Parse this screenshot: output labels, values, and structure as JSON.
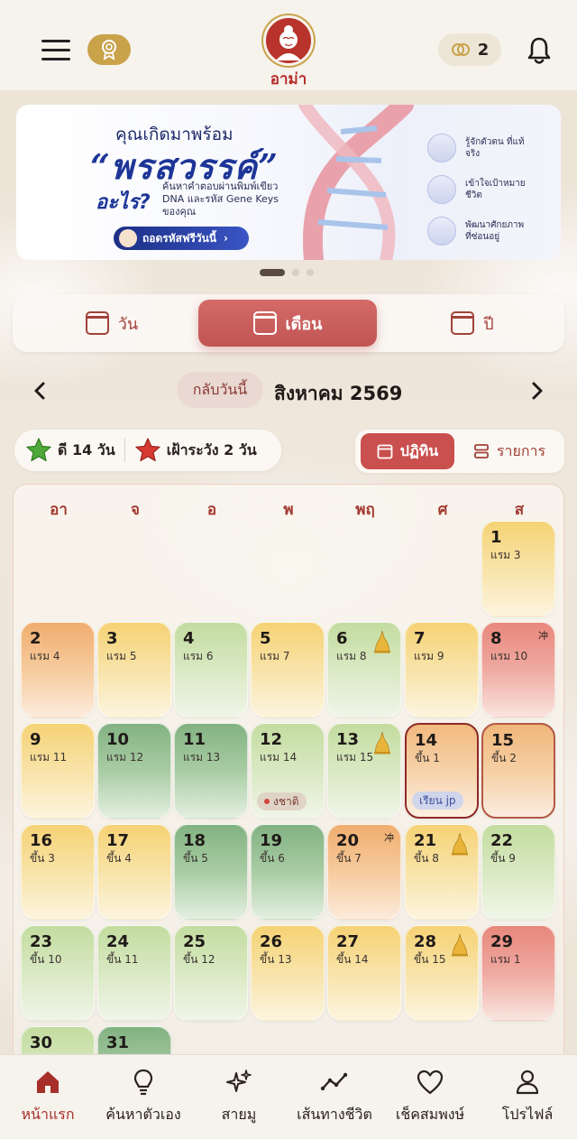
{
  "header": {
    "logo_label": "อาม่า",
    "coins": "2"
  },
  "banner": {
    "line1": "คุณเกิดมาพร้อม",
    "headline": "“พรสวรรค์”",
    "question": "อะไร?",
    "subtitle": "ค้นหาคำตอบผ่านพิมพ์เขียว DNA และรหัส Gene Keys ของคุณ",
    "cta": "ถอดรหัสฟรีวันนี้",
    "features": [
      {
        "text": "รู้จักตัวตน ที่แท้จริง",
        "icon": "brain-icon"
      },
      {
        "text": "เข้าใจเป้าหมาย ชีวิต",
        "icon": "target-icon"
      },
      {
        "text": "พัฒนาศักยภาพ ที่ซ่อนอยู่",
        "icon": "person-icon"
      }
    ],
    "slides": 3,
    "active_slide": 1
  },
  "view_tabs": [
    {
      "label": "วัน",
      "active": false
    },
    {
      "label": "เดือน",
      "active": true
    },
    {
      "label": "ปี",
      "active": false
    }
  ],
  "month_nav": {
    "today_label": "กลับวันนี้",
    "month_title": "สิงหาคม 2569"
  },
  "summary": {
    "good": "ดี 14 วัน",
    "caution": "เฝ้าระวัง 2 วัน"
  },
  "layout_toggle": {
    "calendar_label": "ปฏิทิน",
    "list_label": "รายการ"
  },
  "weekdays": [
    "อา",
    "จ",
    "อ",
    "พ",
    "พฤ",
    "ศ",
    "ส"
  ],
  "days": [
    {
      "d": "1",
      "l": "แรม 3",
      "tone": "yellow"
    },
    {
      "d": "2",
      "l": "แรม 4",
      "tone": "orange"
    },
    {
      "d": "3",
      "l": "แรม 5",
      "tone": "yellow"
    },
    {
      "d": "4",
      "l": "แรม 6",
      "tone": "lgreen"
    },
    {
      "d": "5",
      "l": "แรม 7",
      "tone": "yellow"
    },
    {
      "d": "6",
      "l": "แรม 8",
      "tone": "lgreen",
      "stupa": true
    },
    {
      "d": "7",
      "l": "แรม 9",
      "tone": "yellow"
    },
    {
      "d": "8",
      "l": "แรม 10",
      "tone": "red",
      "chong": "冲"
    },
    {
      "d": "9",
      "l": "แรม 11",
      "tone": "yellow"
    },
    {
      "d": "10",
      "l": "แรม 12",
      "tone": "dgreen"
    },
    {
      "d": "11",
      "l": "แรม 13",
      "tone": "dgreen"
    },
    {
      "d": "12",
      "l": "แรม 14",
      "tone": "lgreen",
      "event": "งชาติ",
      "event_style": "red"
    },
    {
      "d": "13",
      "l": "แรม 15",
      "tone": "lgreen",
      "stupa": true
    },
    {
      "d": "14",
      "l": "ขึ้น 1",
      "tone": "sel14",
      "event": "เรียน jp",
      "event_style": "blue"
    },
    {
      "d": "15",
      "l": "ขึ้น 2",
      "tone": "sel15"
    },
    {
      "d": "16",
      "l": "ขึ้น 3",
      "tone": "yellow"
    },
    {
      "d": "17",
      "l": "ขึ้น 4",
      "tone": "yellow"
    },
    {
      "d": "18",
      "l": "ขึ้น 5",
      "tone": "dgreen"
    },
    {
      "d": "19",
      "l": "ขึ้น 6",
      "tone": "dgreen"
    },
    {
      "d": "20",
      "l": "ขึ้น 7",
      "tone": "orange",
      "chong": "冲"
    },
    {
      "d": "21",
      "l": "ขึ้น 8",
      "tone": "yellow",
      "stupa": true
    },
    {
      "d": "22",
      "l": "ขึ้น 9",
      "tone": "lgreen"
    },
    {
      "d": "23",
      "l": "ขึ้น 10",
      "tone": "lgreen"
    },
    {
      "d": "24",
      "l": "ขึ้น 11",
      "tone": "lgreen"
    },
    {
      "d": "25",
      "l": "ขึ้น 12",
      "tone": "lgreen"
    },
    {
      "d": "26",
      "l": "ขึ้น 13",
      "tone": "yellow"
    },
    {
      "d": "27",
      "l": "ขึ้น 14",
      "tone": "yellow"
    },
    {
      "d": "28",
      "l": "ขึ้น 15",
      "tone": "yellow",
      "stupa": true
    },
    {
      "d": "29",
      "l": "แรม 1",
      "tone": "red"
    },
    {
      "d": "30",
      "l": "",
      "tone": "lgreen"
    },
    {
      "d": "31",
      "l": "",
      "tone": "dgreen"
    }
  ],
  "first_weekday": 6,
  "bottom_nav": [
    {
      "label": "หน้าแรก",
      "icon": "home-icon",
      "active": true
    },
    {
      "label": "ค้นหาตัวเอง",
      "icon": "lightbulb-icon",
      "active": false
    },
    {
      "label": "สายมู",
      "icon": "sparkles-icon",
      "active": false
    },
    {
      "label": "เส้นทางชีวิต",
      "icon": "trend-line-icon",
      "active": false
    },
    {
      "label": "เช็คสมพงษ์",
      "icon": "heart-icon",
      "active": false
    },
    {
      "label": "โปรไฟล์",
      "icon": "profile-icon",
      "active": false
    }
  ],
  "colors": {
    "accent": "#c9504e",
    "brand_red": "#b8332c",
    "gold": "#c9a24a"
  }
}
